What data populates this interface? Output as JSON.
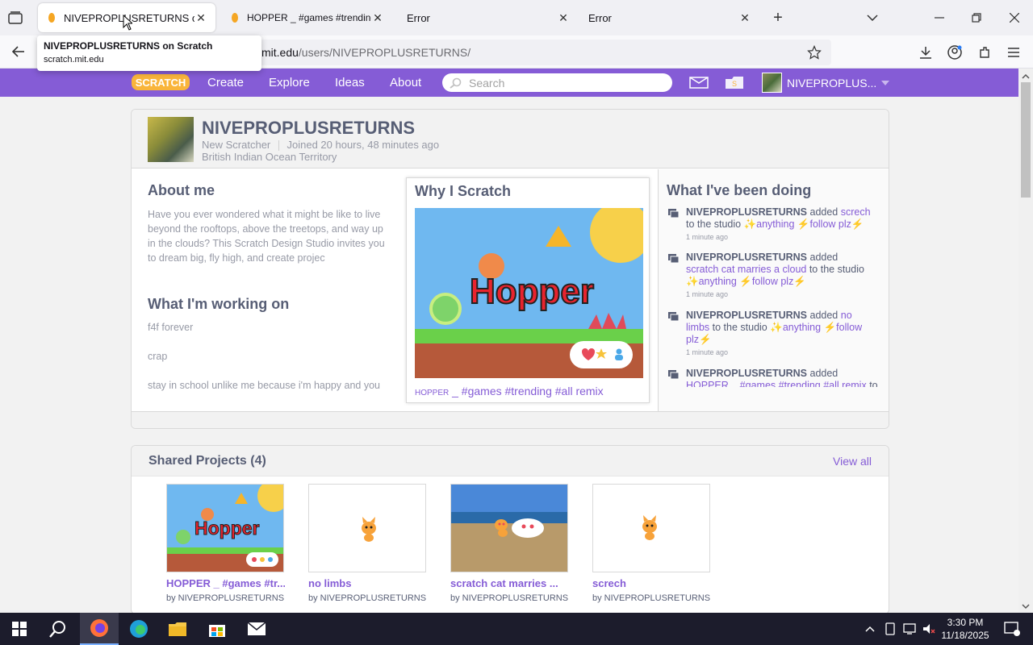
{
  "browser": {
    "tabs": [
      {
        "title": "NIVEPROPLUSRETURNS on Scratch",
        "active": true
      },
      {
        "title": "HOPPER _ #games #trending #all",
        "active": false
      },
      {
        "title": "Error",
        "active": false
      },
      {
        "title": "Error",
        "active": false
      }
    ],
    "url_host": "mit.edu",
    "url_path": "/users/NIVEPROPLUSRETURNS/",
    "tooltip": {
      "title": "NIVEPROPLUSRETURNS on Scratch",
      "host": "scratch.mit.edu"
    }
  },
  "scratch_nav": {
    "logo": "SCRATCH",
    "links": [
      "Create",
      "Explore",
      "Ideas",
      "About"
    ],
    "search_placeholder": "Search",
    "username": "NIVEPROPLUS..."
  },
  "profile": {
    "username": "NIVEPROPLUSRETURNS",
    "role": "New Scratcher",
    "joined": "Joined 20 hours, 48 minutes ago",
    "location": "British Indian Ocean Territory",
    "about_title": "About me",
    "about_text": "Have you ever wondered what it might be like to live beyond the rooftops, above the treetops, and way up in the clouds? This Scratch Design Studio invites you to dream big, fly high, and create projec",
    "working_title": "What I'm working on",
    "working_lines": [
      "f4f forever",
      "crap",
      "stay in school unlike me because i'm happy and you"
    ],
    "featured_title": "Why I Scratch",
    "featured_project_prefix": "HOPPER",
    "featured_project_suffix": " _ #games #trending #all remix",
    "activity_title": "What I've been doing",
    "activity": [
      {
        "who": "NIVEPROPLUSRETURNS",
        "verb": " added ",
        "item": "screch",
        "mid": " to the studio ",
        "studio1": "anything",
        "studio2": "follow plz",
        "when": "1 minute ago"
      },
      {
        "who": "NIVEPROPLUSRETURNS",
        "verb": " added ",
        "item": "scratch cat marries a cloud",
        "mid": " to the studio ",
        "studio1": "anything",
        "studio2": "follow plz",
        "when": "1 minute ago"
      },
      {
        "who": "NIVEPROPLUSRETURNS",
        "verb": " added ",
        "item": "no limbs",
        "mid": " to the studio ",
        "studio1": "anything",
        "studio2": "follow plz",
        "when": "1 minute ago"
      },
      {
        "who": "NIVEPROPLUSRETURNS",
        "verb": " added ",
        "item": "HOPPER _ #games #trending #all remix",
        "mid": " to",
        "studio1": "",
        "studio2": "",
        "when": ""
      }
    ]
  },
  "shared": {
    "title": "Shared Projects (4)",
    "view_all": "View all",
    "projects": [
      {
        "title": "HOPPER _ #games #tr...",
        "by": "by NIVEPROPLUSRETURNS"
      },
      {
        "title": "no limbs",
        "by": "by NIVEPROPLUSRETURNS"
      },
      {
        "title": "scratch cat marries ...",
        "by": "by NIVEPROPLUSRETURNS"
      },
      {
        "title": "screch",
        "by": "by NIVEPROPLUSRETURNS"
      }
    ]
  },
  "thumb_text": {
    "hopper": "Hopper"
  },
  "taskbar": {
    "time": "3:30 PM",
    "date": "11/18/2025"
  },
  "colors": {
    "scratch_purple": "#855cd6",
    "text": "#575e75",
    "muted": "#979aa6"
  }
}
